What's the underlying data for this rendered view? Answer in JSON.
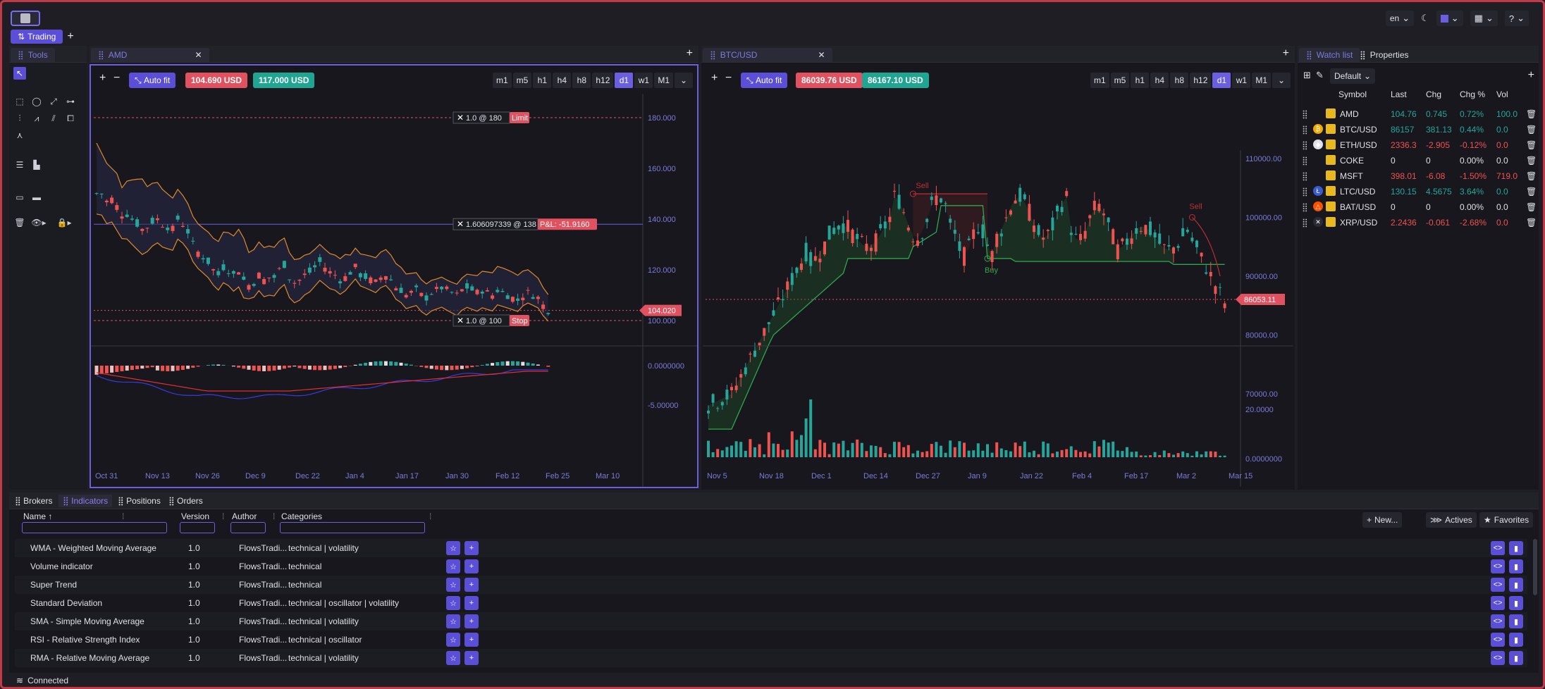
{
  "app": {
    "language": "en",
    "tab": "Trading"
  },
  "tools": {
    "title": "Tools"
  },
  "amd": {
    "tab": "AMD",
    "autofit": "Auto fit",
    "bid": "104.690 USD",
    "ask": "117.000 USD",
    "timeframes": [
      "m1",
      "m5",
      "h1",
      "h4",
      "h8",
      "h12",
      "d1",
      "w1",
      "M1"
    ],
    "selected_tf": "d1",
    "y_ticks": [
      "180.000",
      "160.000",
      "140.000",
      "120.000",
      "100.000"
    ],
    "osc_ticks": [
      "0.0000000",
      "-5.00000"
    ],
    "x_ticks": [
      "Oct 31",
      "Nov 13",
      "Nov 26",
      "Dec 9",
      "Dec 22",
      "Jan 4",
      "Jan 17",
      "Jan 30",
      "Feb 12",
      "Feb 25",
      "Mar 10"
    ],
    "limit_order": "1.0 @ 180",
    "limit_label": "Limit",
    "position": "1.606097339 @ 138",
    "pnl": "P&L: -51.9160",
    "stop_order": "1.0 @ 100",
    "stop_label": "Stop",
    "last_price": "104.020"
  },
  "btc": {
    "tab": "BTC/USD",
    "autofit": "Auto fit",
    "bid": "86039.76 USD",
    "ask": "86167.10 USD",
    "timeframes": [
      "m1",
      "m5",
      "h1",
      "h4",
      "h8",
      "h12",
      "d1",
      "w1",
      "M1"
    ],
    "selected_tf": "d1",
    "y_ticks": [
      "110000.00",
      "100000.00",
      "90000.00",
      "80000.00",
      "70000.00"
    ],
    "vol_ticks": [
      "20.0000",
      "0.0000000"
    ],
    "x_ticks": [
      "Nov 5",
      "Nov 18",
      "Dec 1",
      "Dec 14",
      "Dec 27",
      "Jan 9",
      "Jan 22",
      "Feb 4",
      "Feb 17",
      "Mar 2",
      "Mar 15"
    ],
    "last_price": "86053.11",
    "sell1": "Sell",
    "sell2": "Sell",
    "buy": "Buy"
  },
  "watchlist": {
    "tabs": [
      "Watch list",
      "Properties"
    ],
    "list_name": "Default",
    "headers": [
      "Symbol",
      "Last",
      "Chg",
      "Chg %",
      "Vol"
    ],
    "rows": [
      {
        "symbol": "AMD",
        "last": "104.76",
        "chg": "0.745",
        "pct": "0.72%",
        "vol": "100.0",
        "dir": "up",
        "coin": ""
      },
      {
        "symbol": "BTC/USD",
        "last": "86157",
        "chg": "381.13",
        "pct": "0.44%",
        "vol": "0.0",
        "dir": "up",
        "coin": "btc"
      },
      {
        "symbol": "ETH/USD",
        "last": "2336.3",
        "chg": "-2.905",
        "pct": "-0.12%",
        "vol": "0.0",
        "dir": "down",
        "coin": "eth"
      },
      {
        "symbol": "COKE",
        "last": "0",
        "chg": "0",
        "pct": "0.00%",
        "vol": "0.0",
        "dir": "flat",
        "coin": ""
      },
      {
        "symbol": "MSFT",
        "last": "398.01",
        "chg": "-6.08",
        "pct": "-1.50%",
        "vol": "719.0",
        "dir": "down",
        "coin": ""
      },
      {
        "symbol": "LTC/USD",
        "last": "130.15",
        "chg": "4.5675",
        "pct": "3.64%",
        "vol": "0.0",
        "dir": "up",
        "coin": "ltc"
      },
      {
        "symbol": "BAT/USD",
        "last": "0",
        "chg": "0",
        "pct": "0.00%",
        "vol": "0.0",
        "dir": "flat",
        "coin": "bat"
      },
      {
        "symbol": "XRP/USD",
        "last": "2.2436",
        "chg": "-0.061",
        "pct": "-2.68%",
        "vol": "0.0",
        "dir": "down",
        "coin": "xrp"
      }
    ]
  },
  "bottom": {
    "tabs": [
      "Brokers",
      "Indicators",
      "Positions",
      "Orders"
    ],
    "headers": {
      "name": "Name",
      "version": "Version",
      "author": "Author",
      "categories": "Categories"
    },
    "actions": {
      "new": "New...",
      "actives": "Actives",
      "favorites": "Favorites"
    },
    "rows": [
      {
        "name": "WMA - Weighted Moving Average",
        "version": "1.0",
        "author": "FlowsTradi...",
        "categories": "technical | volatility"
      },
      {
        "name": "Volume indicator",
        "version": "1.0",
        "author": "FlowsTradi...",
        "categories": "technical"
      },
      {
        "name": "Super Trend",
        "version": "1.0",
        "author": "FlowsTradi...",
        "categories": "technical"
      },
      {
        "name": "Standard Deviation",
        "version": "1.0",
        "author": "FlowsTradi...",
        "categories": "technical | oscillator | volatility"
      },
      {
        "name": "SMA - Simple Moving Average",
        "version": "1.0",
        "author": "FlowsTradi...",
        "categories": "technical | volatility"
      },
      {
        "name": "RSI - Relative Strength Index",
        "version": "1.0",
        "author": "FlowsTradi...",
        "categories": "technical | oscillator"
      },
      {
        "name": "RMA - Relative Moving Average",
        "version": "1.0",
        "author": "FlowsTradi...",
        "categories": "technical | volatility"
      }
    ]
  },
  "status": {
    "text": "Connected"
  },
  "colors": {
    "accent": "#6b5fe0",
    "up": "#26a69a",
    "down": "#ef5350",
    "bg": "#17171d"
  }
}
